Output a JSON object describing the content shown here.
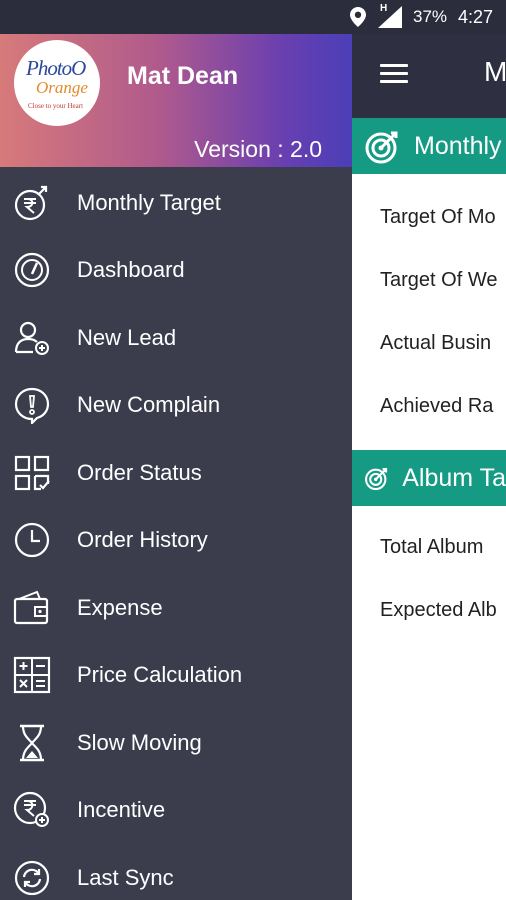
{
  "status_bar": {
    "network_indicator": "H",
    "battery": "37%",
    "time": "4:27",
    "icons": [
      "location-icon",
      "signal-icon"
    ]
  },
  "drawer": {
    "user_name": "Mat Dean",
    "version": "Version : 2.0",
    "logo": {
      "text_main": "PhotoO",
      "text_sub": "Orange",
      "tagline": "Close to your Heart"
    },
    "items": [
      {
        "label": "Monthly Target",
        "icon": "rupee-target-icon"
      },
      {
        "label": "Dashboard",
        "icon": "gauge-icon"
      },
      {
        "label": "New Lead",
        "icon": "add-user-icon"
      },
      {
        "label": "New Complain",
        "icon": "complaint-icon"
      },
      {
        "label": "Order Status",
        "icon": "grid-check-icon"
      },
      {
        "label": "Order History",
        "icon": "clock-icon"
      },
      {
        "label": "Expense",
        "icon": "wallet-icon"
      },
      {
        "label": "Price Calculation",
        "icon": "calculator-icon"
      },
      {
        "label": "Slow Moving",
        "icon": "hourglass-icon"
      },
      {
        "label": "Incentive",
        "icon": "rupee-add-icon"
      },
      {
        "label": "Last Sync",
        "icon": "sync-icon"
      }
    ]
  },
  "main": {
    "title": "M",
    "sections": [
      {
        "title": "Monthly",
        "rows": [
          "Target Of Mo",
          "Target Of We",
          "Actual Busin",
          "Achieved Ra"
        ]
      },
      {
        "title": "Album Ta",
        "rows": [
          "Total Album",
          "Expected Alb"
        ]
      }
    ]
  },
  "colors": {
    "drawer_bg": "#3b3d4d",
    "toolbar_bg": "#2e3042",
    "accent_teal": "#159a83",
    "header_gradient_start": "#d67a7a",
    "header_gradient_end": "#4b3fb8"
  }
}
